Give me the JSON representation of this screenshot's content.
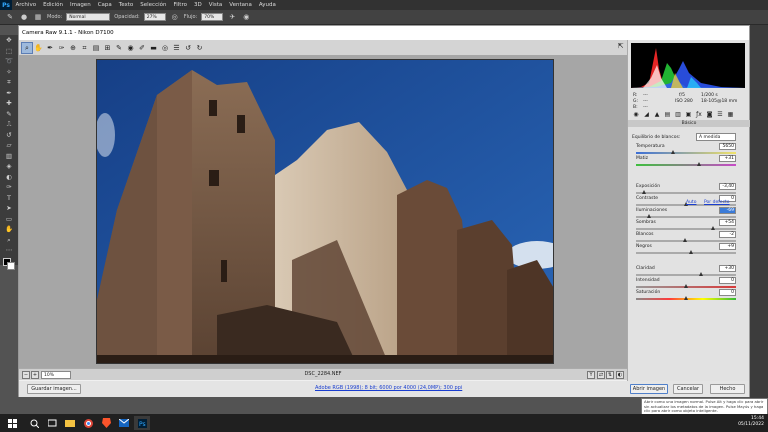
{
  "app": {
    "logo": "Ps",
    "menus": [
      "Archivo",
      "Edición",
      "Imagen",
      "Capa",
      "Texto",
      "Selección",
      "Filtro",
      "3D",
      "Vista",
      "Ventana",
      "Ayuda"
    ]
  },
  "options": {
    "mode_label": "Modo:",
    "mode_value": "Normal",
    "opacity_label": "Opacidad:",
    "opacity_value": "27%",
    "flow_label": "Flujo:",
    "flow_value": "70%"
  },
  "dialog": {
    "title": "Camera Raw 9.1.1 - Nikon D7100",
    "zoom": "10%",
    "filename": "DSC_2284.NEF",
    "buttons": {
      "save": "Guardar imagen...",
      "open": "Abrir imagen",
      "cancel": "Cancelar",
      "done": "Hecho"
    },
    "workflow_link": "Adobe RGB (1998); 8 bit; 6000 por 4000 (24,0MP); 300 ppi"
  },
  "panel": {
    "readout": {
      "r": "R:",
      "g": "G:",
      "b": "B:",
      "dash": "---",
      "aperture": "f/5",
      "shutter": "1/200 s",
      "iso": "ISO 280",
      "lens": "18-105@18 mm"
    },
    "section_title": "Básico",
    "wb_label": "Equilibrio de blancos:",
    "wb_value": "A medida",
    "auto_link": "Auto",
    "default_link": "Por defecto",
    "sliders": [
      {
        "label": "Temperatura",
        "value": "5650",
        "pos": 0.37,
        "track": "temp"
      },
      {
        "label": "Matiz",
        "value": "+31",
        "pos": 0.63,
        "track": "tint"
      },
      {
        "label": "Exposición",
        "value": "-3,40",
        "pos": 0.08,
        "track": "gray"
      },
      {
        "label": "Contraste",
        "value": "0",
        "pos": 0.5,
        "track": "gray"
      },
      {
        "label": "Iluminaciones",
        "value": "-69",
        "pos": 0.13,
        "track": "gray",
        "selected": true
      },
      {
        "label": "Sombras",
        "value": "+54",
        "pos": 0.77,
        "track": "gray"
      },
      {
        "label": "Blancos",
        "value": "-2",
        "pos": 0.49,
        "track": "gray"
      },
      {
        "label": "Negros",
        "value": "+9",
        "pos": 0.55,
        "track": "gray"
      },
      {
        "label": "Claridad",
        "value": "+30",
        "pos": 0.65,
        "track": "gray"
      },
      {
        "label": "Intensidad",
        "value": "0",
        "pos": 0.5,
        "track": "vib"
      },
      {
        "label": "Saturación",
        "value": "0",
        "pos": 0.5,
        "track": "sat"
      }
    ]
  },
  "tooltip": "Abrir como una imagen normal. Pulse Alt y haga clic para abrir sin actualizar los metadatos de la imagen. Pulse Mayús y haga clic para abrir como objeto inteligente.",
  "taskbar": {
    "time": "15:44",
    "date": "05/11/2022"
  },
  "colors": {
    "accent": "#4f7fc9",
    "selected": "#3b7bd8",
    "link": "#1a3ecf",
    "sky": "#1c4d96"
  }
}
